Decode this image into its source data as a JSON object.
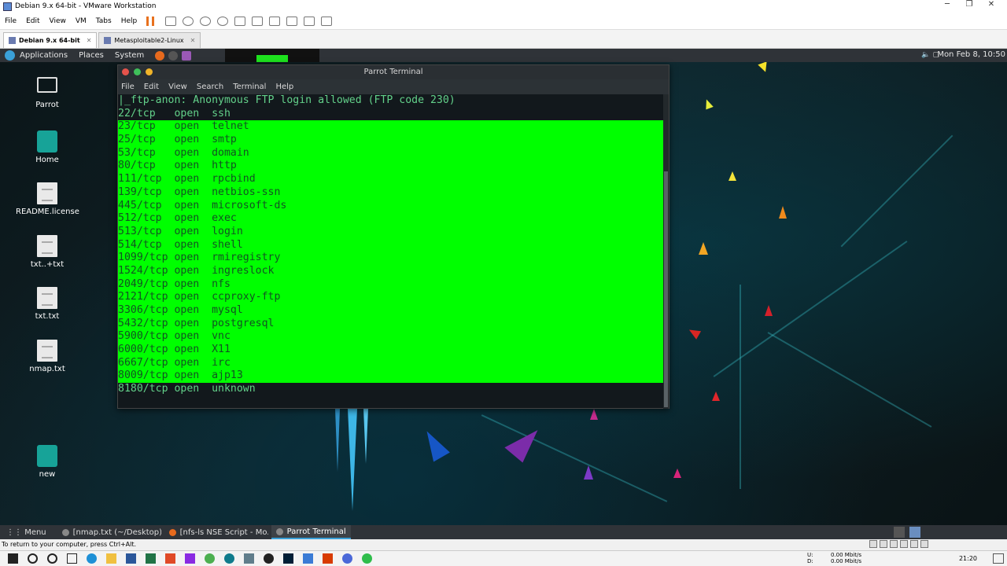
{
  "vm": {
    "window_title": "Debian 9.x 64-bit - VMware Workstation",
    "controls": {
      "minimize": "─",
      "maximize": "❐",
      "close": "✕"
    },
    "menu": [
      "File",
      "Edit",
      "View",
      "VM",
      "Tabs",
      "Help"
    ],
    "tabs": [
      {
        "label": "Debian 9.x 64-bit",
        "close": "✕"
      },
      {
        "label": "Metasploitable2-Linux",
        "close": "✕"
      }
    ],
    "status_text": "To return to your computer, press Ctrl+Alt."
  },
  "guest": {
    "panel": {
      "items": [
        "Applications",
        "Places",
        "System"
      ],
      "clock": "Mon Feb 8, 10:50"
    },
    "desktop_icons": [
      {
        "label": "Parrot"
      },
      {
        "label": "Home"
      },
      {
        "label": "README.license"
      },
      {
        "label": "txt..+txt"
      },
      {
        "label": "txt.txt"
      },
      {
        "label": "nmap.txt"
      },
      {
        "label": "new"
      }
    ],
    "terminal": {
      "title": "Parrot Terminal",
      "menu": [
        "File",
        "Edit",
        "View",
        "Search",
        "Terminal",
        "Help"
      ],
      "lines": [
        {
          "text": "|_ftp-anon: Anonymous FTP login allowed (FTP code 230)",
          "selected": false
        },
        {
          "text": "22/tcp   open  ssh",
          "selected": false
        },
        {
          "text": "23/tcp   open  telnet",
          "selected": true
        },
        {
          "text": "25/tcp   open  smtp",
          "selected": true
        },
        {
          "text": "53/tcp   open  domain",
          "selected": true
        },
        {
          "text": "80/tcp   open  http",
          "selected": true
        },
        {
          "text": "111/tcp  open  rpcbind",
          "selected": true
        },
        {
          "text": "139/tcp  open  netbios-ssn",
          "selected": true
        },
        {
          "text": "445/tcp  open  microsoft-ds",
          "selected": true
        },
        {
          "text": "512/tcp  open  exec",
          "selected": true
        },
        {
          "text": "513/tcp  open  login",
          "selected": true
        },
        {
          "text": "514/tcp  open  shell",
          "selected": true
        },
        {
          "text": "1099/tcp open  rmiregistry",
          "selected": true
        },
        {
          "text": "1524/tcp open  ingreslock",
          "selected": true
        },
        {
          "text": "2049/tcp open  nfs",
          "selected": true
        },
        {
          "text": "2121/tcp open  ccproxy-ftp",
          "selected": true
        },
        {
          "text": "3306/tcp open  mysql",
          "selected": true
        },
        {
          "text": "5432/tcp open  postgresql",
          "selected": true
        },
        {
          "text": "5900/tcp open  vnc",
          "selected": true
        },
        {
          "text": "6000/tcp open  X11",
          "selected": true
        },
        {
          "text": "6667/tcp open  irc",
          "selected": true
        },
        {
          "text": "8009/tcp open  ajp13",
          "selected": true
        },
        {
          "text": "8180/tcp open  unknown",
          "selected": false
        }
      ]
    },
    "taskbar": {
      "menu": "Menu",
      "tasks": [
        {
          "label": "[nmap.txt (~/Desktop) - ..."
        },
        {
          "label": "[nfs-ls NSE Script - Mo..."
        },
        {
          "label": "Parrot Terminal"
        }
      ]
    }
  },
  "host": {
    "net_labels": [
      "U:",
      "D:"
    ],
    "net_values": [
      "0.00 Mbit/s",
      "0.00 Mbit/s"
    ],
    "time": "21:20"
  },
  "colors": {
    "selection": "#00ff00",
    "terminal_text": "#63d18a",
    "terminal_bg": "#12181c"
  }
}
